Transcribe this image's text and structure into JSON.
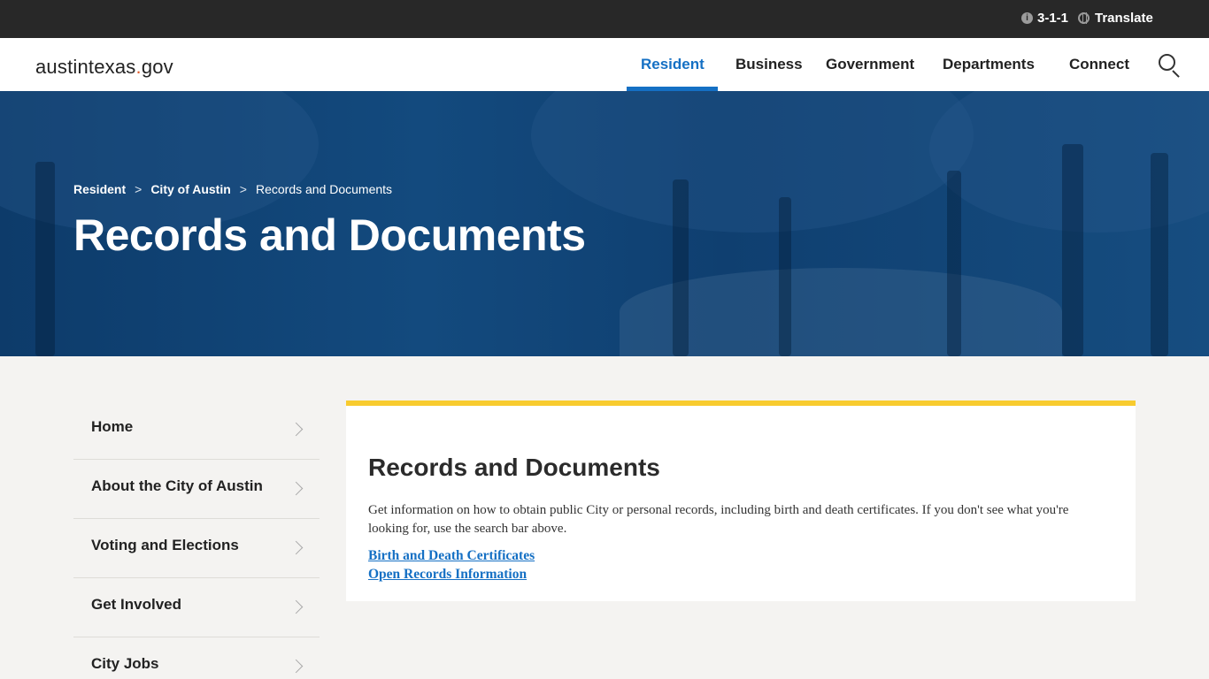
{
  "utility": {
    "phone_label": "3-1-1",
    "phone_icon": "info-icon",
    "translate_label": "Translate",
    "translate_icon": "globe-icon"
  },
  "header": {
    "logo_main": "austintexas",
    "logo_dot": ".",
    "logo_tld": "gov",
    "nav": [
      {
        "label": "Resident",
        "active": true
      },
      {
        "label": "Business"
      },
      {
        "label": "Government"
      },
      {
        "label": "Departments"
      },
      {
        "label": "Connect"
      }
    ],
    "search_icon": "search-icon",
    "accent_color": "#1570c4"
  },
  "hero": {
    "breadcrumb": [
      {
        "label": "Resident"
      },
      {
        "label": "City of Austin"
      },
      {
        "label": "Records and Documents"
      }
    ],
    "separator": ">",
    "title": "Records and Documents"
  },
  "sidebar": {
    "items": [
      {
        "label": "Home"
      },
      {
        "label": "About the City of Austin"
      },
      {
        "label": "Voting and Elections"
      },
      {
        "label": "Get Involved"
      },
      {
        "label": "City Jobs"
      }
    ]
  },
  "content": {
    "title": "Records and Documents",
    "description": "Get information on how to obtain public City or personal records, including birth and death certificates. If you don't see what you're looking for, use the search bar above.",
    "links": [
      {
        "label": "Birth and Death Certificates"
      },
      {
        "label": "Open Records Information"
      }
    ],
    "card_accent_color": "#f8cb2e"
  }
}
